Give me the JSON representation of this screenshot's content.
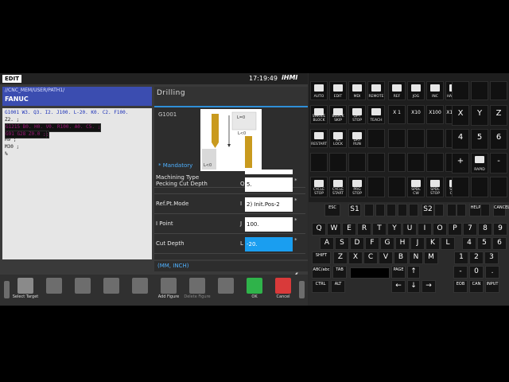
{
  "header": {
    "mode": "EDIT",
    "clock": "17:19:49",
    "logo": "iHMI"
  },
  "program": {
    "path": "//CNC_MEM/USER/PATH1/",
    "brand": "FANUC",
    "lines": [
      {
        "text": "G1001 W3. Q3. I2. J100. L-20. K0. C2. F100.",
        "style": "hl"
      },
      {
        "text": " Z2. ;",
        "style": "normal"
      },
      {
        "text": "G1215 B0. H0. V0. R100. A0. C5. ;",
        "style": "pk"
      },
      {
        "text": "",
        "style": "normal"
      },
      {
        "text": "G0 G90 Z100.0 ;",
        "style": "pk"
      },
      {
        "text": "G91 G28 Z0.0 ;",
        "style": "pk"
      },
      {
        "text": "M5 ;",
        "style": "normal"
      },
      {
        "text": "M9 ;",
        "style": "normal"
      },
      {
        "text": "M30 ;",
        "style": "normal"
      },
      {
        "text": "%",
        "style": "normal"
      }
    ]
  },
  "cycle": {
    "title": "Drilling",
    "gcode": "G1001",
    "mandatory": "* Mandatory",
    "figure_labels": [
      "L=0",
      "L<0",
      "L<0"
    ],
    "rows": [
      {
        "label": "Machining Type",
        "letter": "",
        "value": "",
        "mark": ""
      },
      {
        "label": "Pecking Cut Depth",
        "letter": "Q",
        "value": "5.",
        "mark": "*"
      },
      {
        "label": "Ref.Pt.Mode",
        "letter": "I",
        "value": "2) Init.Pos-2",
        "mark": "*"
      },
      {
        "label": "I Point",
        "letter": "J",
        "value": "100.",
        "mark": "*"
      },
      {
        "label": "Cut Depth",
        "letter": "L",
        "value": "-20.",
        "mark": "*"
      }
    ],
    "unit": "(MM, INCH)"
  },
  "softkeys": {
    "select_target": "Select\nTarget",
    "add_figure": "Add\nFigure",
    "delete_figure": "Delete\nFigure",
    "ok": "OK",
    "cancel": "Cancel",
    "ok_color": "#2fb34a",
    "cancel_color": "#d93a3a"
  },
  "machine_keys": {
    "row1": [
      "AUTO",
      "EDIT",
      "MDI",
      "REMOTE",
      "REF",
      "JOG",
      "INC",
      "HANDLE"
    ],
    "row2": [
      "SINGLE BLOCK",
      "BLOCK SKIP",
      "OPT STOP",
      "TEACH",
      "X 1",
      "X10",
      "X100",
      "X1000"
    ],
    "row3": [
      "RESTART",
      "MC LOCK",
      "DRY RUN"
    ],
    "row4": [
      "CYCLE STOP",
      "CYCLE START",
      "PRG STOP",
      "SPDL CW",
      "SPDL STOP",
      "SPDL CCW"
    ],
    "axes": [
      "X",
      "Y",
      "Z",
      "4",
      "5",
      "6",
      "+",
      "RAPID",
      "-"
    ]
  },
  "keyboard": {
    "top": [
      "ESC",
      "S1",
      "S2",
      "HELP",
      "CANCEL"
    ],
    "row1": [
      "Q",
      "W",
      "E",
      "R",
      "T",
      "Y",
      "U",
      "I",
      "O",
      "P",
      "7",
      "8",
      "9"
    ],
    "row2": [
      "A",
      "S",
      "D",
      "F",
      "G",
      "H",
      "J",
      "K",
      "L",
      "4",
      "5",
      "6"
    ],
    "row3": [
      "SHIFT",
      "Z",
      "X",
      "C",
      "V",
      "B",
      "N",
      "M",
      "1",
      "2",
      "3"
    ],
    "row4": [
      "ABC/abc",
      "TAB",
      "PAGE",
      "-",
      "0",
      "."
    ],
    "row5": [
      "CTRL",
      "ALT",
      "EOB",
      "CAN",
      "INPUT"
    ]
  }
}
